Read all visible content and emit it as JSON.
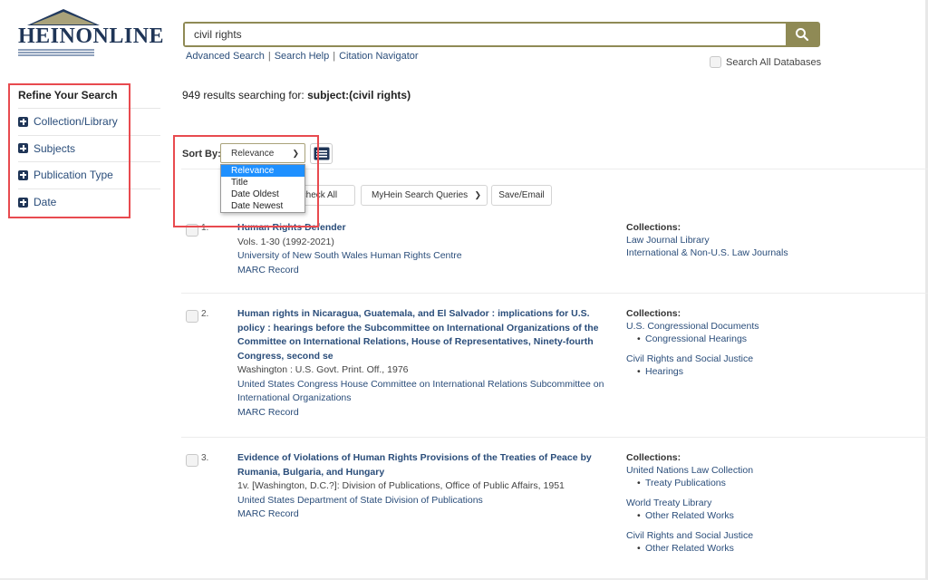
{
  "logo": {
    "text_main": "HEIN",
    "text_second": "ONLINE"
  },
  "search": {
    "value": "civil rights",
    "links": [
      "Advanced Search",
      "Search Help",
      "Citation Navigator"
    ],
    "search_all_label": "Search All Databases"
  },
  "sidebar": {
    "title": "Refine Your Search",
    "items": [
      {
        "label": "Collection/Library"
      },
      {
        "label": "Subjects"
      },
      {
        "label": "Publication Type"
      },
      {
        "label": "Date"
      }
    ]
  },
  "results_header": {
    "count_text": "949 results searching for: ",
    "query": "subject:(civil rights)"
  },
  "sort": {
    "label": "Sort By:",
    "selected": "Relevance",
    "options": [
      "Relevance",
      "Title",
      "Date Oldest",
      "Date Newest"
    ]
  },
  "toolbar": {
    "uncheck_all": "Uncheck All",
    "myhein": "MyHein Search Queries",
    "save_email": "Save/Email"
  },
  "results": [
    {
      "number": "1.",
      "title": "Human Rights Defender",
      "meta": "Vols. 1-30 (1992-2021)",
      "author": "University of New South Wales Human Rights Centre",
      "marc": "MARC Record",
      "collections_label": "Collections:",
      "collections": [
        {
          "name": "Law Journal Library",
          "subs": []
        },
        {
          "name": "International & Non-U.S. Law Journals",
          "subs": []
        }
      ]
    },
    {
      "number": "2.",
      "title": "Human rights in Nicaragua, Guatemala, and El Salvador : implications for U.S. policy : hearings before the Subcommittee on International Organizations of the Committee on International Relations, House of Representatives, Ninety-fourth Congress, second se",
      "meta": "Washington : U.S. Govt. Print. Off., 1976",
      "author": "United States Congress House Committee on International Relations Subcommittee on International Organizations",
      "marc": "MARC Record",
      "collections_label": "Collections:",
      "collections": [
        {
          "name": "U.S. Congressional Documents",
          "subs": [
            "Congressional Hearings"
          ]
        },
        {
          "name": "Civil Rights and Social Justice",
          "subs": [
            "Hearings"
          ]
        }
      ]
    },
    {
      "number": "3.",
      "title": "Evidence of Violations of Human Rights Provisions of the Treaties of Peace by Rumania, Bulgaria, and Hungary",
      "meta": "1v. [Washington, D.C.?]: Division of Publications, Office of Public Affairs, 1951",
      "author": "United States Department of State Division of Publications",
      "marc": "MARC Record",
      "collections_label": "Collections:",
      "collections": [
        {
          "name": "United Nations Law Collection",
          "subs": [
            "Treaty Publications"
          ]
        },
        {
          "name": "World Treaty Library",
          "subs": [
            "Other Related Works"
          ]
        },
        {
          "name": "Civil Rights and Social Justice",
          "subs": [
            "Other Related Works"
          ]
        }
      ]
    }
  ],
  "colors": {
    "brand_navy": "#1f3557",
    "search_olive": "#8f8a55",
    "link_blue": "#2a4d7a",
    "highlight_red": "#e84a4f",
    "dropdown_selected": "#1e90ff"
  }
}
